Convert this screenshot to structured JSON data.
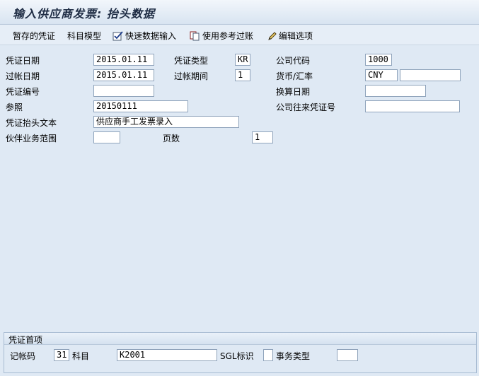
{
  "title": "输入供应商发票: 抬头数据",
  "toolbar": {
    "parked": "暂存的凭证",
    "account_model": "科目模型",
    "fast_entry": "快速数据输入",
    "reference_post": "使用参考过账",
    "edit_options": "编辑选项"
  },
  "header": {
    "doc_date_label": "凭证日期",
    "doc_date": "2015.01.11",
    "doc_type_label": "凭证类型",
    "doc_type": "KR",
    "company_code_label": "公司代码",
    "company_code": "1000",
    "posting_date_label": "过帐日期",
    "posting_date": "2015.01.11",
    "period_label": "过帐期间",
    "period": "1",
    "currency_label": "货币/汇率",
    "currency": "CNY",
    "exchange_rate": "",
    "doc_number_label": "凭证编号",
    "doc_number": "",
    "translation_date_label": "换算日期",
    "translation_date": "",
    "reference_label": "参照",
    "reference": "20150111",
    "cross_cc_label": "公司往来凭证号",
    "cross_cc": "",
    "header_text_label": "凭证抬头文本",
    "header_text": "供应商手工发票录入",
    "trading_partner_label": "伙伴业务范围",
    "trading_partner": "",
    "page_label": "页数",
    "page": "1"
  },
  "first_item": {
    "section_title": "凭证首项",
    "posting_key_label": "记帐码",
    "posting_key": "31",
    "account_label": "科目",
    "account": "K2001",
    "sgl_label": "SGL标识",
    "sgl": "",
    "transaction_type_label": "事务类型",
    "transaction_type": ""
  }
}
